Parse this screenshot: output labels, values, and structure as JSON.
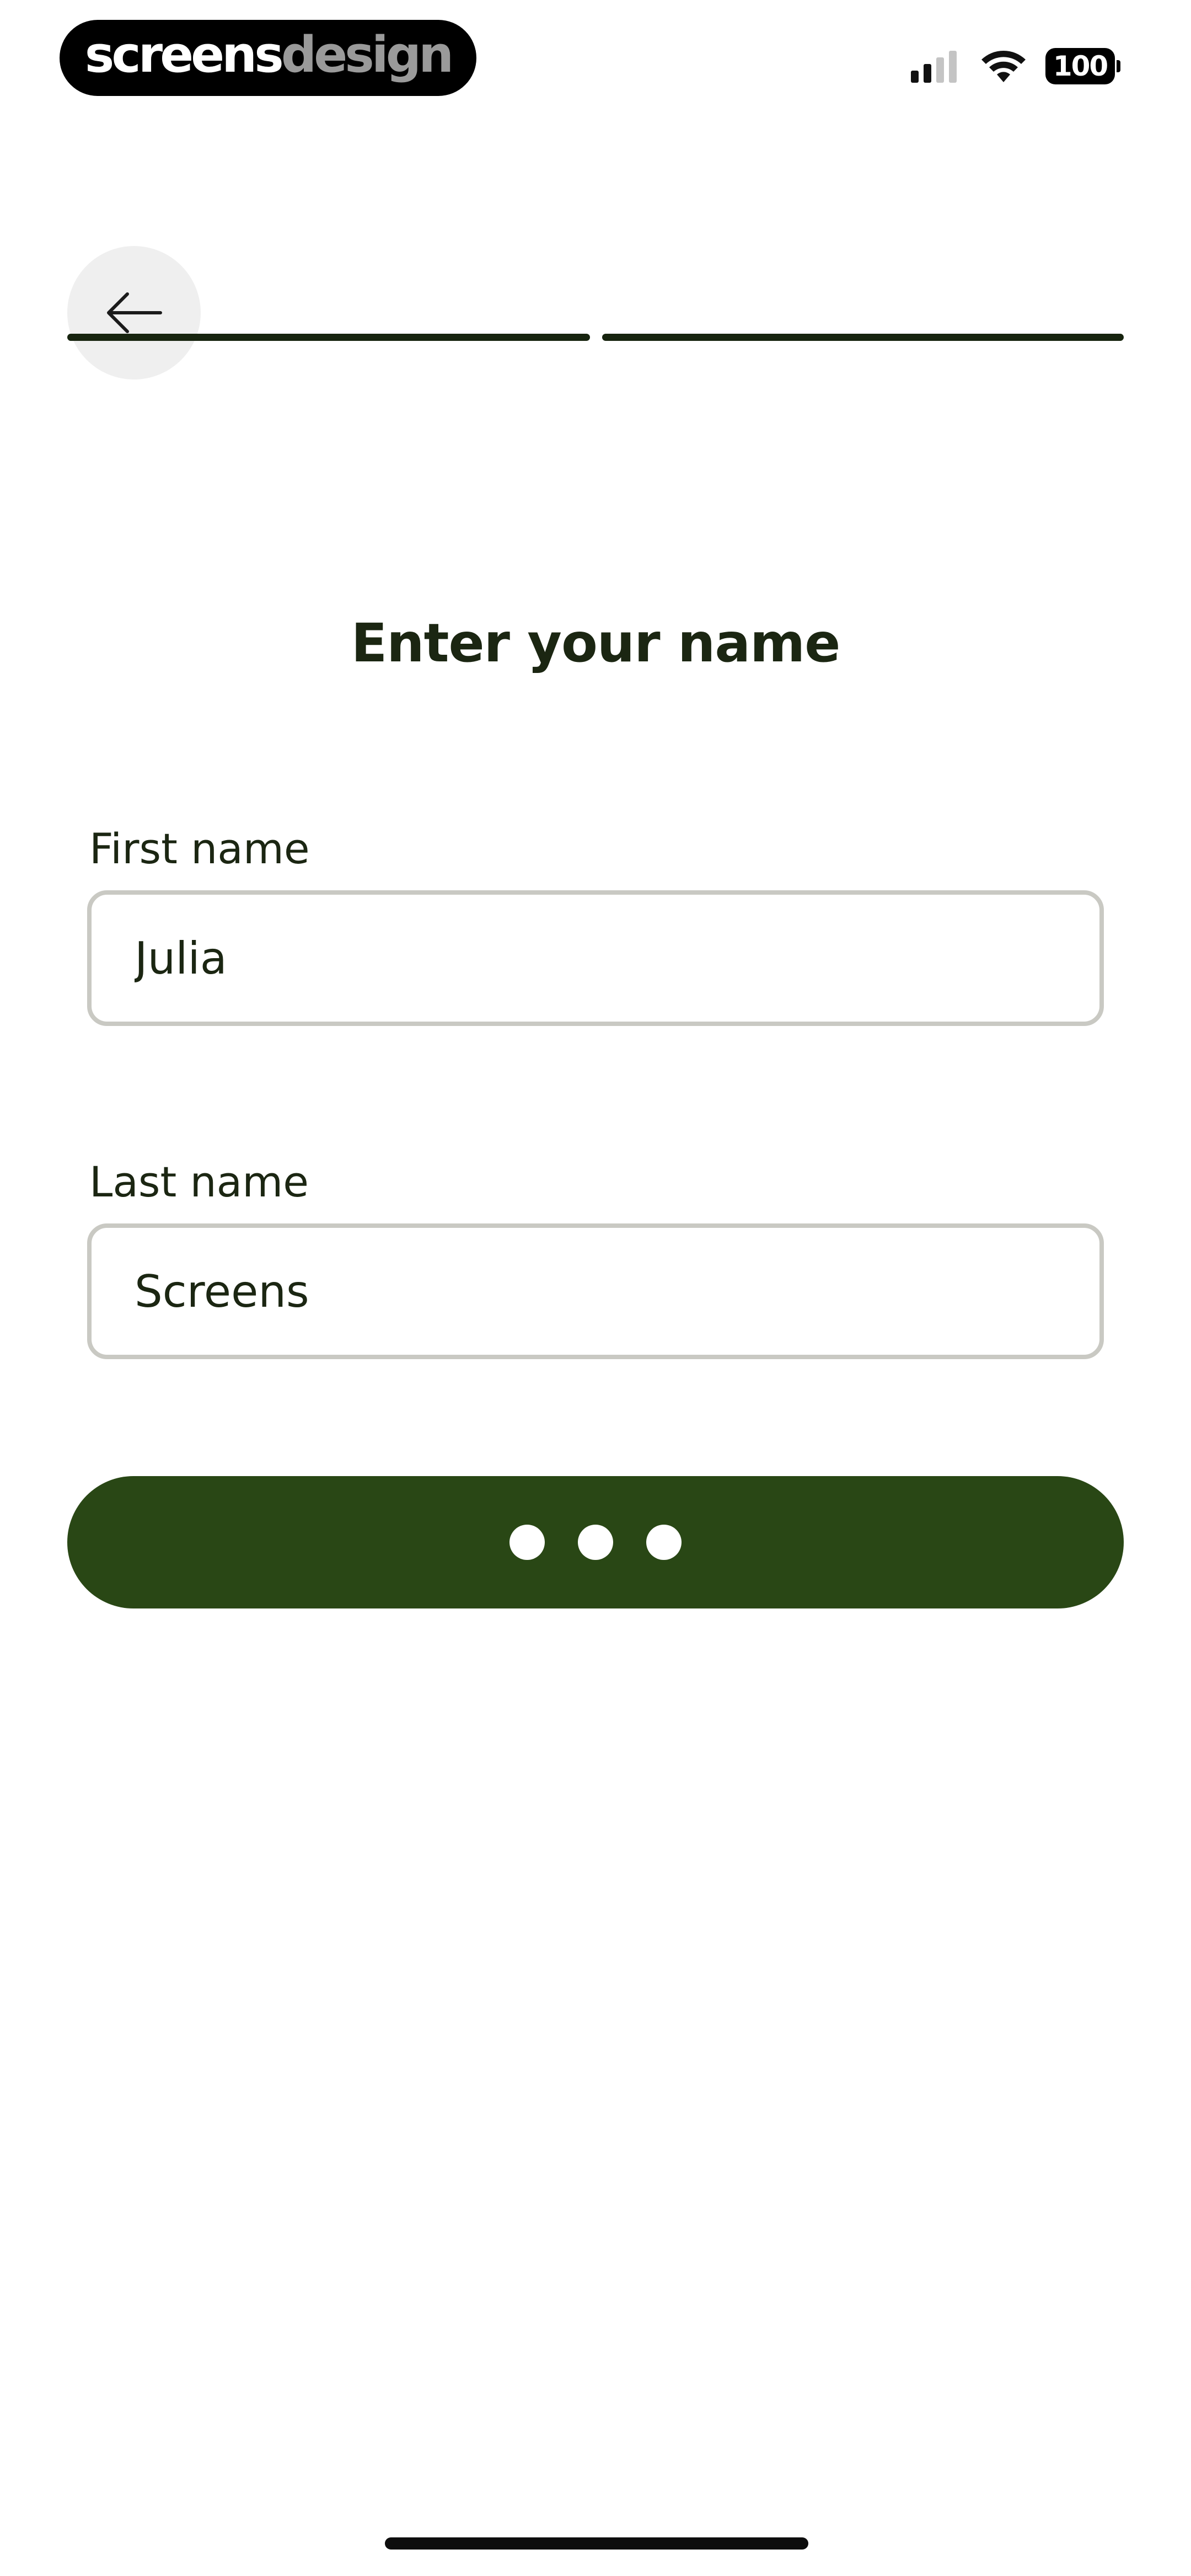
{
  "status_bar": {
    "brand_primary": "screens",
    "brand_secondary": "design",
    "battery_level": "100",
    "signal_bars_active": 2,
    "signal_bars_total": 4
  },
  "header": {
    "back_icon": "arrow-left-icon",
    "progress_segments": 2,
    "progress_color": "#17240f"
  },
  "title": "Enter your name",
  "form": {
    "first_name": {
      "label": "First name",
      "value": "Julia"
    },
    "last_name": {
      "label": "Last name",
      "value": "Screens"
    }
  },
  "continue_button": {
    "state": "loading",
    "color": "#294715",
    "indicator_icon": "loading-dots-icon"
  }
}
